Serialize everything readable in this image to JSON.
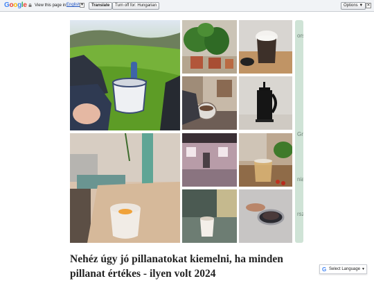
{
  "translate_bar": {
    "logo": "Google",
    "view_text": "View this page in:",
    "language": "English",
    "language_arrow": "▼",
    "translate_label": "Translate",
    "turn_off_label": "Turn off for: Hungarian",
    "options_label": "Options ▼",
    "close_label": "✕"
  },
  "map_strip": {
    "labels": [
      "ors",
      "Gr",
      "nia",
      "rsz"
    ]
  },
  "post": {
    "title": "Nehéz úgy jó pillanatokat kiemelni, ha minden pillanat értékes - ilyen volt 2024"
  },
  "language_selector": {
    "icon": "G",
    "label": "Select Language",
    "arrow": "▼"
  }
}
